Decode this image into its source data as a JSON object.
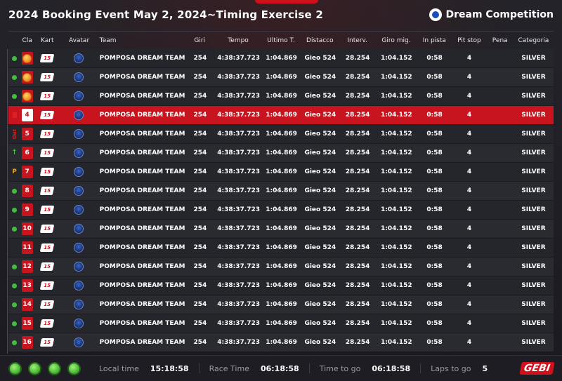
{
  "header": {
    "title": "2024 Booking Event May 2, 2024~Timing Exercise 2",
    "brand": "Dream Competition"
  },
  "columns": [
    "Cla",
    "Kart",
    "Avatar",
    "Team",
    "Giri",
    "Tempo",
    "Ultimo T.",
    "Distacco",
    "Interv.",
    "Giro mig.",
    "In pista",
    "Pit stop",
    "Pena",
    "Categoria"
  ],
  "rows": [
    {
      "status": "dot",
      "status_text": "",
      "pos": "",
      "pos_style": "medal",
      "kart": "15",
      "team": "POMPOSA DREAM TEAM",
      "giri": "254",
      "tempo": "4:38:37.723",
      "ultimo": "1:04.869",
      "distacco": "Gieo 524",
      "interv": "28.254",
      "giro_mig": "1:04.152",
      "in_pista": "0:58",
      "pit_stop": "4",
      "pena": "",
      "categoria": "SILVER"
    },
    {
      "status": "dot",
      "status_text": "",
      "pos": "",
      "pos_style": "medal",
      "kart": "15",
      "team": "POMPOSA DREAM TEAM",
      "giri": "254",
      "tempo": "4:38:37.723",
      "ultimo": "1:04.869",
      "distacco": "Gieo 524",
      "interv": "28.254",
      "giro_mig": "1:04.152",
      "in_pista": "0:58",
      "pit_stop": "4",
      "pena": "",
      "categoria": "SILVER"
    },
    {
      "status": "dot",
      "status_text": "",
      "pos": "",
      "pos_style": "medal",
      "kart": "15",
      "team": "POMPOSA DREAM TEAM",
      "giri": "254",
      "tempo": "4:38:37.723",
      "ultimo": "1:04.869",
      "distacco": "Gieo 524",
      "interv": "28.254",
      "giro_mig": "1:04.152",
      "in_pista": "0:58",
      "pit_stop": "4",
      "pena": "",
      "categoria": "SILVER"
    },
    {
      "status": "flag",
      "status_text": "",
      "pos": "4",
      "pos_style": "white",
      "kart": "15",
      "team": "POMPOSA DREAM TEAM",
      "giri": "254",
      "tempo": "4:38:37.723",
      "ultimo": "1:04.869",
      "distacco": "Gieo 524",
      "interv": "28.254",
      "giro_mig": "1:04.152",
      "in_pista": "0:58",
      "pit_stop": "4",
      "pena": "",
      "categoria": "SILVER",
      "highlight": true
    },
    {
      "status": "out",
      "status_text": "Out",
      "pos": "5",
      "pos_style": "red",
      "kart": "15",
      "team": "POMPOSA DREAM TEAM",
      "giri": "254",
      "tempo": "4:38:37.723",
      "ultimo": "1:04.869",
      "distacco": "Gieo 524",
      "interv": "28.254",
      "giro_mig": "1:04.152",
      "in_pista": "0:58",
      "pit_stop": "4",
      "pena": "",
      "categoria": "SILVER"
    },
    {
      "status": "up",
      "status_text": "↑",
      "pos": "6",
      "pos_style": "red",
      "kart": "15",
      "team": "POMPOSA DREAM TEAM",
      "giri": "254",
      "tempo": "4:38:37.723",
      "ultimo": "1:04.869",
      "distacco": "Gieo 524",
      "interv": "28.254",
      "giro_mig": "1:04.152",
      "in_pista": "0:58",
      "pit_stop": "4",
      "pena": "",
      "categoria": "SILVER"
    },
    {
      "status": "pit",
      "status_text": "P",
      "pos": "7",
      "pos_style": "red",
      "kart": "15",
      "team": "POMPOSA DREAM TEAM",
      "giri": "254",
      "tempo": "4:38:37.723",
      "ultimo": "1:04.869",
      "distacco": "Gieo 524",
      "interv": "28.254",
      "giro_mig": "1:04.152",
      "in_pista": "0:58",
      "pit_stop": "4",
      "pena": "",
      "categoria": "SILVER"
    },
    {
      "status": "dot",
      "status_text": "",
      "pos": "8",
      "pos_style": "red",
      "kart": "15",
      "team": "POMPOSA DREAM TEAM",
      "giri": "254",
      "tempo": "4:38:37.723",
      "ultimo": "1:04.869",
      "distacco": "Gieo 524",
      "interv": "28.254",
      "giro_mig": "1:04.152",
      "in_pista": "0:58",
      "pit_stop": "4",
      "pena": "",
      "categoria": "SILVER"
    },
    {
      "status": "dot",
      "status_text": "",
      "pos": "9",
      "pos_style": "red",
      "kart": "15",
      "team": "POMPOSA DREAM TEAM",
      "giri": "254",
      "tempo": "4:38:37.723",
      "ultimo": "1:04.869",
      "distacco": "Gieo 524",
      "interv": "28.254",
      "giro_mig": "1:04.152",
      "in_pista": "0:58",
      "pit_stop": "4",
      "pena": "",
      "categoria": "SILVER"
    },
    {
      "status": "dot",
      "status_text": "",
      "pos": "10",
      "pos_style": "red",
      "kart": "15",
      "team": "POMPOSA DREAM TEAM",
      "giri": "254",
      "tempo": "4:38:37.723",
      "ultimo": "1:04.869",
      "distacco": "Gieo 524",
      "interv": "28.254",
      "giro_mig": "1:04.152",
      "in_pista": "0:58",
      "pit_stop": "4",
      "pena": "",
      "categoria": "SILVER"
    },
    {
      "status": "none",
      "status_text": "",
      "pos": "11",
      "pos_style": "red",
      "kart": "15",
      "team": "POMPOSA DREAM TEAM",
      "giri": "254",
      "tempo": "4:38:37.723",
      "ultimo": "1:04.869",
      "distacco": "Gieo 524",
      "interv": "28.254",
      "giro_mig": "1:04.152",
      "in_pista": "0:58",
      "pit_stop": "4",
      "pena": "",
      "categoria": "SILVER"
    },
    {
      "status": "dot",
      "status_text": "",
      "pos": "12",
      "pos_style": "red",
      "kart": "15",
      "team": "POMPOSA DREAM TEAM",
      "giri": "254",
      "tempo": "4:38:37.723",
      "ultimo": "1:04.869",
      "distacco": "Gieo 524",
      "interv": "28.254",
      "giro_mig": "1:04.152",
      "in_pista": "0:58",
      "pit_stop": "4",
      "pena": "",
      "categoria": "SILVER"
    },
    {
      "status": "dot",
      "status_text": "",
      "pos": "13",
      "pos_style": "red",
      "kart": "15",
      "team": "POMPOSA DREAM TEAM",
      "giri": "254",
      "tempo": "4:38:37.723",
      "ultimo": "1:04.869",
      "distacco": "Gieo 524",
      "interv": "28.254",
      "giro_mig": "1:04.152",
      "in_pista": "0:58",
      "pit_stop": "4",
      "pena": "",
      "categoria": "SILVER"
    },
    {
      "status": "dot",
      "status_text": "",
      "pos": "14",
      "pos_style": "red",
      "kart": "15",
      "team": "POMPOSA DREAM TEAM",
      "giri": "254",
      "tempo": "4:38:37.723",
      "ultimo": "1:04.869",
      "distacco": "Gieo 524",
      "interv": "28.254",
      "giro_mig": "1:04.152",
      "in_pista": "0:58",
      "pit_stop": "4",
      "pena": "",
      "categoria": "SILVER"
    },
    {
      "status": "dot",
      "status_text": "",
      "pos": "15",
      "pos_style": "red",
      "kart": "15",
      "team": "POMPOSA DREAM TEAM",
      "giri": "254",
      "tempo": "4:38:37.723",
      "ultimo": "1:04.869",
      "distacco": "Gieo 524",
      "interv": "28.254",
      "giro_mig": "1:04.152",
      "in_pista": "0:58",
      "pit_stop": "4",
      "pena": "",
      "categoria": "SILVER"
    },
    {
      "status": "dot",
      "status_text": "",
      "pos": "16",
      "pos_style": "red",
      "kart": "15",
      "team": "POMPOSA DREAM TEAM",
      "giri": "254",
      "tempo": "4:38:37.723",
      "ultimo": "1:04.869",
      "distacco": "Gieo 524",
      "interv": "28.254",
      "giro_mig": "1:04.152",
      "in_pista": "0:58",
      "pit_stop": "4",
      "pena": "",
      "categoria": "SILVER"
    }
  ],
  "footer": {
    "lights_count": 4,
    "local_time_label": "Local time",
    "local_time": "15:18:58",
    "race_time_label": "Race Time",
    "race_time": "06:18:58",
    "time_to_go_label": "Time to go",
    "time_to_go": "06:18:58",
    "laps_to_go_label": "Laps to go",
    "laps_to_go": "5",
    "logo_text": "GEBI"
  },
  "colors": {
    "accent_red": "#c8141e",
    "status_green": "#3fbf3a",
    "pit_orange": "#e8a21a",
    "background": "#1b1b21"
  }
}
